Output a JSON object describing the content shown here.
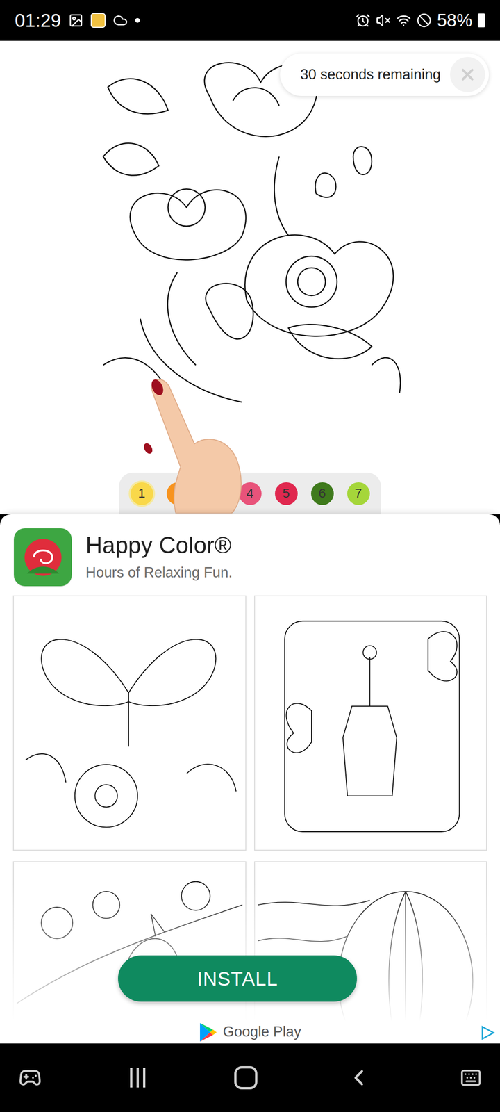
{
  "status_bar": {
    "time": "01:29",
    "battery": "58%"
  },
  "ad": {
    "timer": "30 seconds remaining"
  },
  "palette": [
    {
      "kind": "color",
      "label": "1",
      "color": "#f9d84a",
      "selected": true
    },
    {
      "kind": "color",
      "label": "2",
      "color": "#f7931e",
      "selected": false
    },
    {
      "kind": "covered",
      "label": "",
      "color": "#e8e8e8",
      "selected": false
    },
    {
      "kind": "color",
      "label": "4",
      "color": "#e8537a",
      "selected": false
    },
    {
      "kind": "color",
      "label": "5",
      "color": "#e0284f",
      "selected": false
    },
    {
      "kind": "color",
      "label": "6",
      "color": "#3f7a1c",
      "selected": false
    },
    {
      "kind": "color",
      "label": "7",
      "color": "#a5d63a",
      "selected": false
    }
  ],
  "app": {
    "name": "Happy Color®",
    "tagline": "Hours of Relaxing Fun."
  },
  "install": "INSTALL",
  "store": "Google Play"
}
